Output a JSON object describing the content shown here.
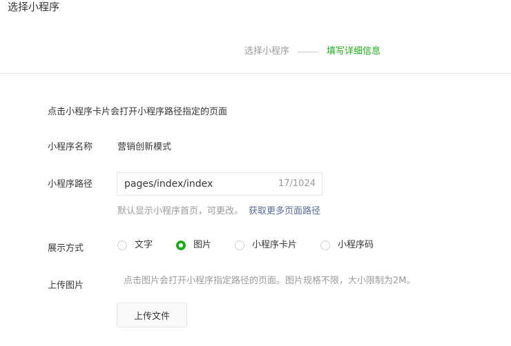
{
  "dialog": {
    "title": "选择小程序"
  },
  "steps": {
    "step1": "选择小程序",
    "step2": "填写详细信息",
    "active_color": "#1aad19"
  },
  "form": {
    "tip": "点击小程序卡片会打开小程序路径指定的页面",
    "name_label": "小程序名称",
    "name_value": "营销创新模式",
    "path_label": "小程序路径",
    "path_value": "pages/index/index",
    "path_counter": "17/1024",
    "path_hint": "默认显示小程序首页，可更改。",
    "path_hint_link": "获取更多页面路径",
    "display_label": "展示方式",
    "display_options": [
      {
        "label": "文字",
        "checked": false
      },
      {
        "label": "图片",
        "checked": true
      },
      {
        "label": "小程序卡片",
        "checked": false
      },
      {
        "label": "小程序码",
        "checked": false
      }
    ],
    "upload_label": "上传图片",
    "upload_tip": "点击图片会打开小程序指定路径的页面。图片规格不限，大小限制为2M。",
    "upload_button": "上传文件"
  }
}
